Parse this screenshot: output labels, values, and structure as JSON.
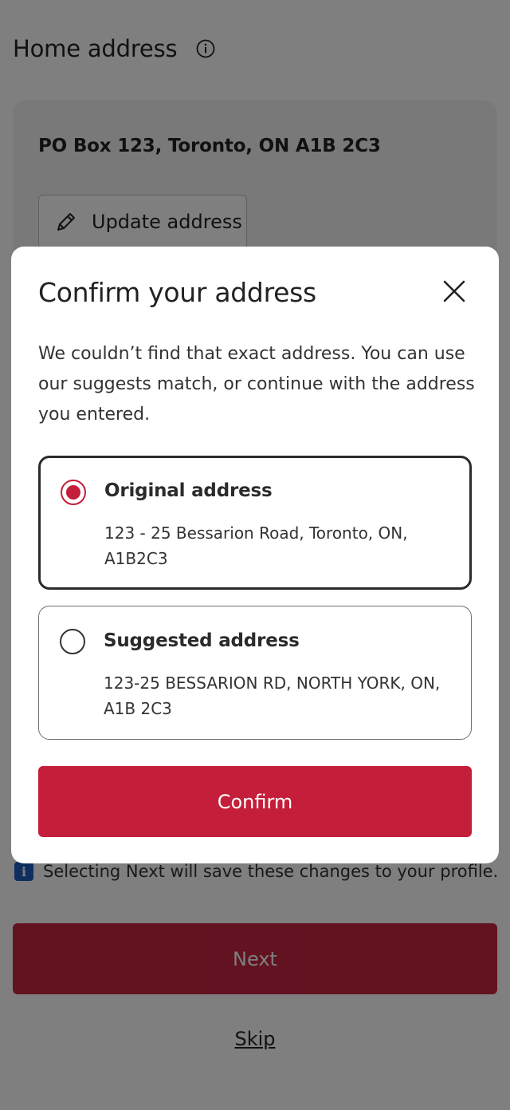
{
  "page": {
    "title": "Home address",
    "info_icon": "info-icon",
    "current_address": "PO Box 123, Toronto, ON A1B 2C3",
    "update_button": {
      "label": "Update address",
      "icon": "pencil-icon"
    },
    "notice": {
      "icon": "info-badge-icon",
      "text": "Selecting Next will save these changes to your profile."
    },
    "next_button": "Next",
    "skip_link": "Skip"
  },
  "modal": {
    "title": "Confirm your address",
    "close_icon": "close-icon",
    "description": "We couldn’t find that exact address. You can use our suggests match, or continue with the address you entered.",
    "options": [
      {
        "title": "Original address",
        "address": "123 - 25 Bessarion Road, Toronto, ON, A1B2C3",
        "selected": true
      },
      {
        "title": "Suggested address",
        "address": "123-25 BESSARION RD, NORTH YORK, ON, A1B 2C3",
        "selected": false
      }
    ],
    "confirm_button": "Confirm"
  },
  "colors": {
    "brand_red": "#c41e3a",
    "info_blue": "#1f5bbf",
    "overlay": "rgba(0,0,0,0.5)"
  }
}
